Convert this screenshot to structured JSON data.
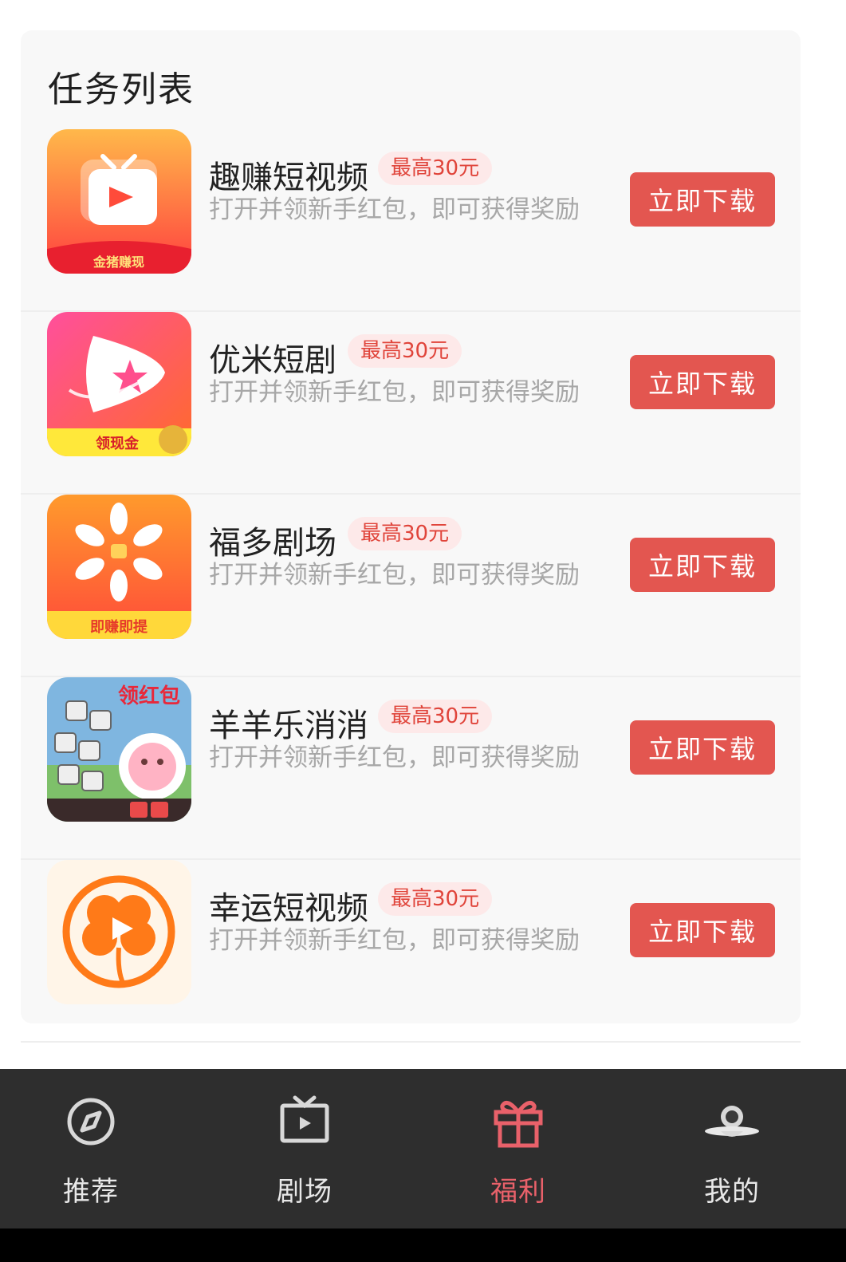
{
  "task_list": {
    "title": "任务列表",
    "items": [
      {
        "name": "趣赚短视频",
        "badge": "最高30元",
        "desc": "打开并领新手红包，即可获得奖励",
        "button": "立即下载",
        "icon_label": "金猪赚现"
      },
      {
        "name": "优米短剧",
        "badge": "最高30元",
        "desc": "打开并领新手红包，即可获得奖励",
        "button": "立即下载",
        "icon_label": "领现金"
      },
      {
        "name": "福多剧场",
        "badge": "最高30元",
        "desc": "打开并领新手红包，即可获得奖励",
        "button": "立即下载",
        "icon_label": "即赚即提"
      },
      {
        "name": "羊羊乐消消",
        "badge": "最高30元",
        "desc": "打开并领新手红包，即可获得奖励",
        "button": "立即下载",
        "icon_label": "领红包"
      },
      {
        "name": "幸运短视频",
        "badge": "最高30元",
        "desc": "打开并领新手红包，即可获得奖励",
        "button": "立即下载",
        "icon_label": ""
      }
    ]
  },
  "tabbar": {
    "tabs": [
      {
        "label": "推荐",
        "icon": "compass-icon",
        "active": false
      },
      {
        "label": "剧场",
        "icon": "tv-icon",
        "active": false
      },
      {
        "label": "福利",
        "icon": "gift-icon",
        "active": true
      },
      {
        "label": "我的",
        "icon": "avatar-icon",
        "active": false
      }
    ]
  },
  "colors": {
    "accent": "#e35650",
    "badge_bg": "#fde9e9",
    "tab_active": "#e9616a",
    "tabbar_bg": "#2e2e2e"
  }
}
